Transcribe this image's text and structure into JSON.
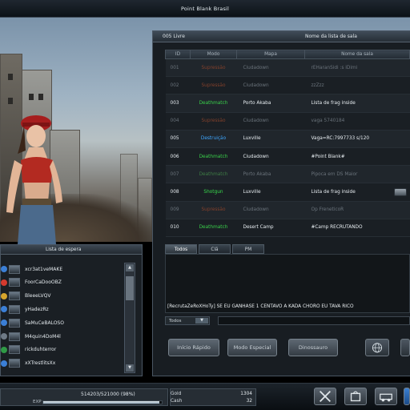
{
  "window": {
    "title": "Point Blank Brasil"
  },
  "room_panel": {
    "channel": "005 Livre",
    "room_name_header": "Nome da lista de sala",
    "columns": [
      "ID",
      "Modo",
      "Mapa",
      "Nome da sala"
    ],
    "rows": [
      {
        "id": "001",
        "mode": "Supressão",
        "mode_key": "supressao",
        "map": "Ciudadown",
        "name": "rEHaranSidi :s iDimi",
        "faded": true,
        "locked": false
      },
      {
        "id": "002",
        "mode": "Supressão",
        "mode_key": "supressao",
        "map": "Ciudadown",
        "name": "zzZzz",
        "faded": true,
        "locked": false
      },
      {
        "id": "003",
        "mode": "Deathmatch",
        "mode_key": "deathmatch",
        "map": "Porto Akaba",
        "name": "Lista de frag inside",
        "faded": false,
        "locked": false
      },
      {
        "id": "004",
        "mode": "Supressão",
        "mode_key": "supressao",
        "map": "Ciudadown",
        "name": "vaga 5740184",
        "faded": true,
        "locked": false
      },
      {
        "id": "005",
        "mode": "Destruição",
        "mode_key": "destruicao",
        "map": "Luxville",
        "name": "Vaga=RC:7997733 s/120",
        "faded": false,
        "locked": false
      },
      {
        "id": "006",
        "mode": "Deathmatch",
        "mode_key": "deathmatch",
        "map": "Ciudadown",
        "name": "#Point Blank#",
        "faded": false,
        "locked": false
      },
      {
        "id": "007",
        "mode": "Deathmatch",
        "mode_key": "deathmatch",
        "map": "Porto Akaba",
        "name": "Pipoca em DS Maior",
        "faded": true,
        "locked": false
      },
      {
        "id": "008",
        "mode": "Shotgun",
        "mode_key": "shotgun",
        "map": "Luxville",
        "name": "Lista de frag inside",
        "faded": false,
        "locked": true
      },
      {
        "id": "009",
        "mode": "Supressão",
        "mode_key": "supressao",
        "map": "Ciudadown",
        "name": "Op FreneticoR",
        "faded": true,
        "locked": false
      },
      {
        "id": "010",
        "mode": "Deathmatch",
        "mode_key": "deathmatch",
        "map": "Desert Camp",
        "name": "#Camp RECRUTANDO",
        "faded": false,
        "locked": false
      }
    ]
  },
  "chat": {
    "tabs": [
      "Todos",
      "Clã",
      "PM"
    ],
    "message": "[RecrutaZeRoXHoTy] SE EU GANHASE 1 CENTAVO A KADA CHORO EU TAVA RICO",
    "target": "Todos"
  },
  "actions": {
    "quick_start": "Início Rápido",
    "special_mode": "Modo Especial",
    "dinosaur": "Dinossauro"
  },
  "team_list": {
    "header": "Lista de espera",
    "players": [
      "xcr3at1veMAKE",
      "FoorCaDooOBZ",
      "BleeeLVQV",
      "yHadezRz",
      "SaMuCeBALOSO",
      "M4quin4DoM4l",
      "rickduhterror",
      "xXTrestlitsXx"
    ]
  },
  "status": {
    "exp_label": "EXP",
    "exp_value": "514203/521000 (98%)",
    "exp_percent": 98,
    "gold_label": "Gold",
    "gold_value": "1304",
    "cash_label": "Cash",
    "cash_value": "32"
  },
  "colors": {
    "supressao": "#e04a22",
    "deathmatch": "#39d14a",
    "destruicao": "#3ea7ff",
    "shotgun": "#38d94c"
  }
}
